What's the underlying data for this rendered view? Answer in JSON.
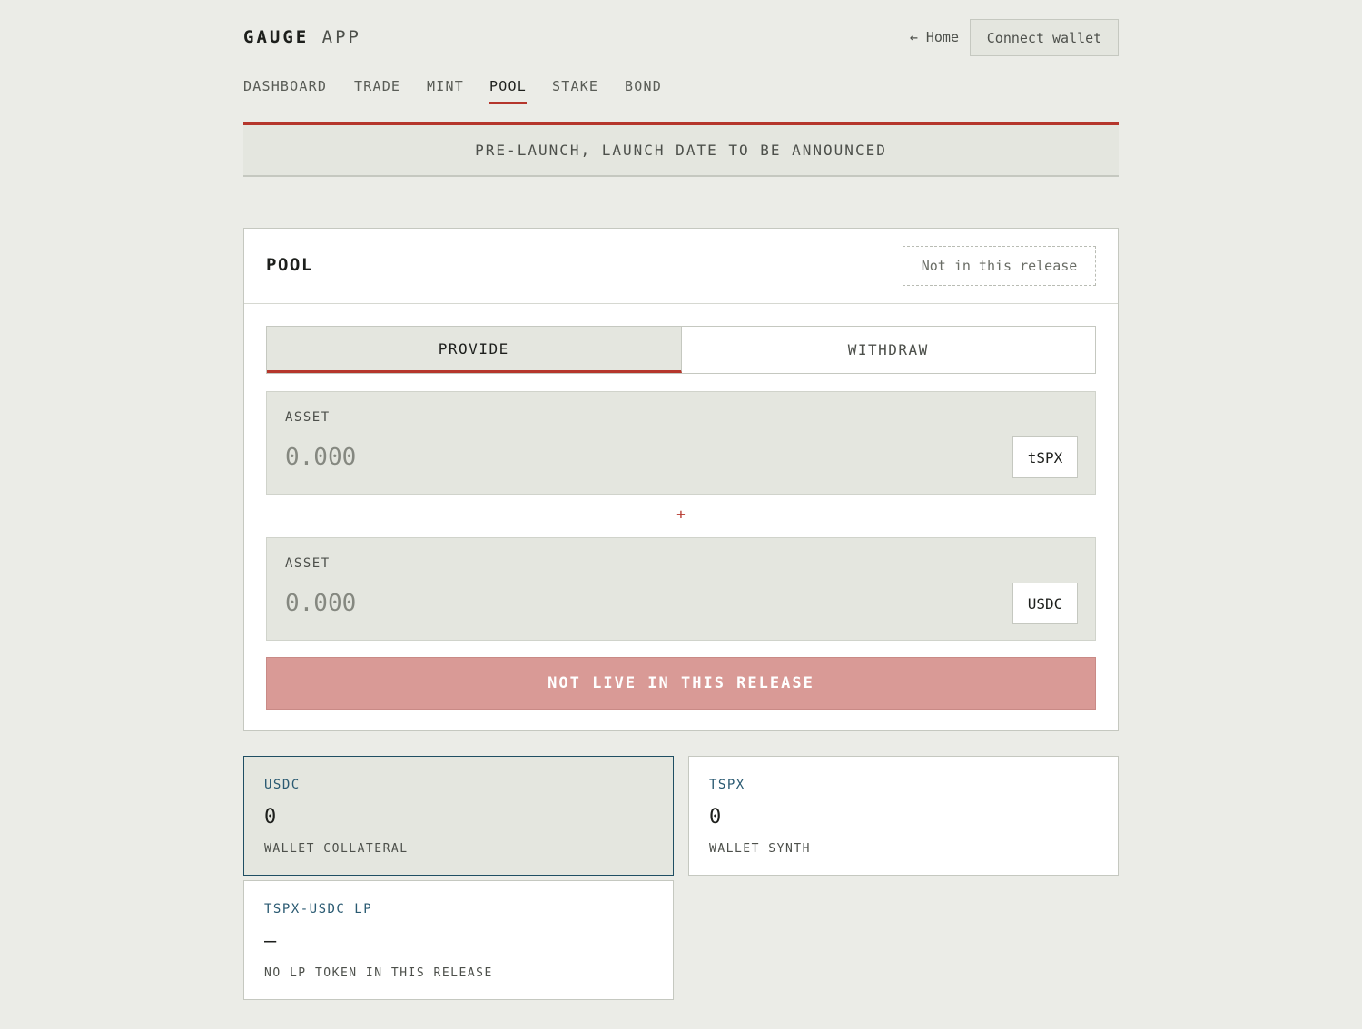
{
  "header": {
    "brand_bold": "GAUGE",
    "brand_light": "APP",
    "home_link": "← Home",
    "connect_label": "Connect wallet"
  },
  "nav": {
    "items": [
      "DASHBOARD",
      "TRADE",
      "MINT",
      "POOL",
      "STAKE",
      "BOND"
    ],
    "active": "POOL"
  },
  "banner": {
    "text": "PRE-LAUNCH, LAUNCH DATE TO BE ANNOUNCED"
  },
  "pool": {
    "title": "POOL",
    "badge": "Not in this release",
    "tabs": [
      "PROVIDE",
      "WITHDRAW"
    ],
    "active_tab": "PROVIDE",
    "assets": [
      {
        "label": "ASSET",
        "placeholder": "0.000",
        "token": "tSPX"
      },
      {
        "label": "ASSET",
        "placeholder": "0.000",
        "token": "USDC"
      }
    ],
    "plus": "+",
    "submit_label": "NOT LIVE IN THIS RELEASE"
  },
  "balances": [
    {
      "symbol": "USDC",
      "value": "0",
      "caption": "WALLET COLLATERAL",
      "selected": true
    },
    {
      "symbol": "TSPX",
      "value": "0",
      "caption": "WALLET SYNTH",
      "selected": false
    },
    {
      "symbol": "TSPX-USDC LP",
      "value": "—",
      "caption": "NO LP TOKEN IN THIS RELEASE",
      "selected": false
    }
  ],
  "colors": {
    "accent": "#b5362c",
    "background": "#ebece7",
    "panel": "#e4e6df",
    "selected_border": "#1f4e63",
    "disabled_button": "#d99a96"
  }
}
